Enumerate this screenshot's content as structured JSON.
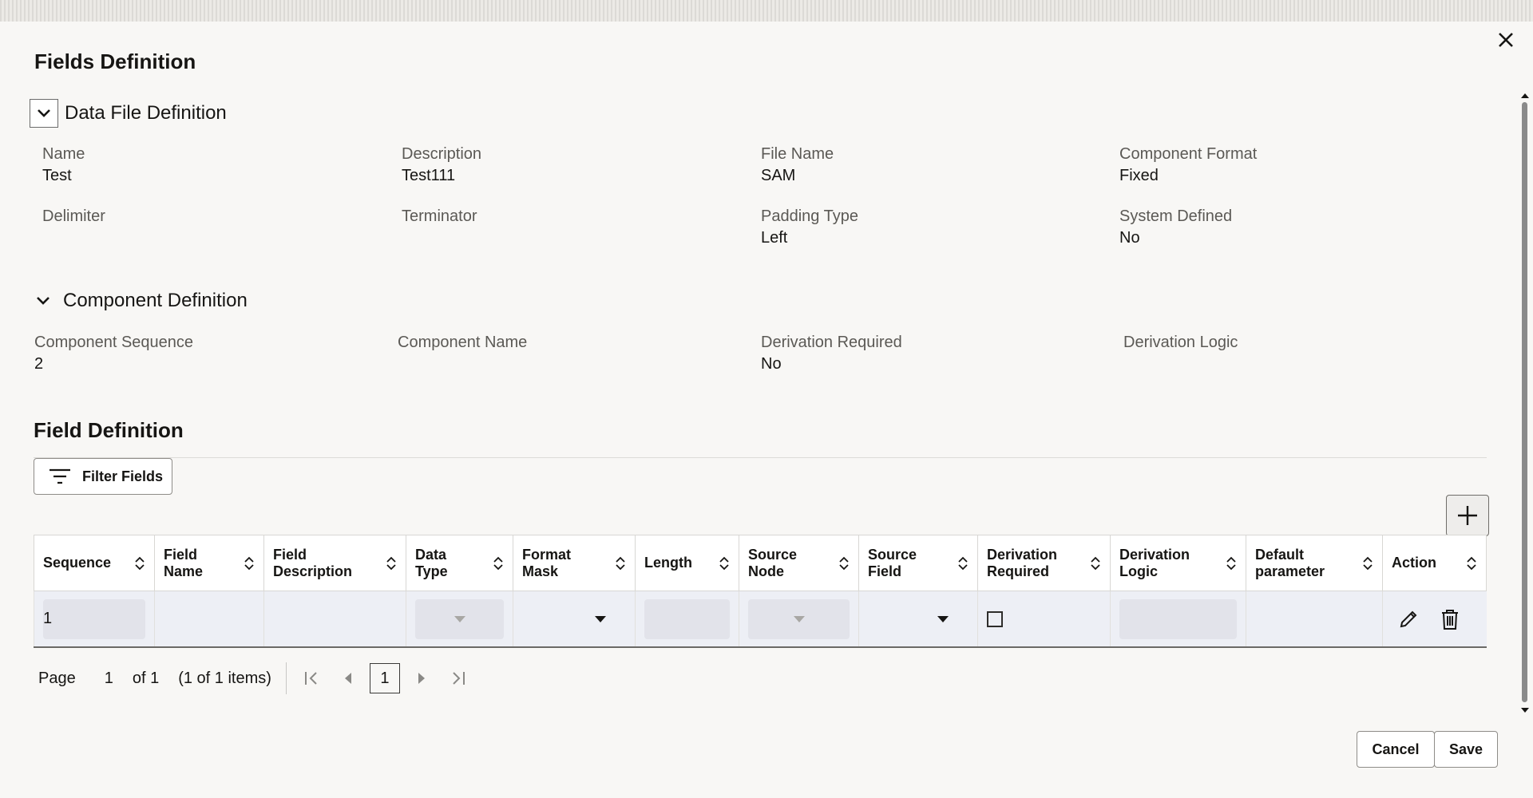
{
  "dialog": {
    "title": "Fields Definition",
    "close_icon": "close-icon"
  },
  "data_file_section": {
    "title": "Data File Definition",
    "fields": [
      {
        "label": "Name",
        "value": "Test"
      },
      {
        "label": "Description",
        "value": "Test111"
      },
      {
        "label": "File Name",
        "value": "SAM"
      },
      {
        "label": "Component Format",
        "value": "Fixed"
      },
      {
        "label": "Delimiter",
        "value": ""
      },
      {
        "label": "Terminator",
        "value": ""
      },
      {
        "label": "Padding Type",
        "value": "Left"
      },
      {
        "label": "System Defined",
        "value": "No"
      }
    ]
  },
  "component_section": {
    "title": "Component Definition",
    "fields": [
      {
        "label": "Component Sequence",
        "value": "2"
      },
      {
        "label": "Component Name",
        "value": ""
      },
      {
        "label": "Derivation Required",
        "value": "No"
      },
      {
        "label": "Derivation Logic",
        "value": ""
      }
    ]
  },
  "field_definition": {
    "title": "Field Definition",
    "filter_label": "Filter Fields",
    "columns": [
      {
        "line1": "Sequence",
        "line2": ""
      },
      {
        "line1": "Field",
        "line2": "Name"
      },
      {
        "line1": "Field",
        "line2": "Description"
      },
      {
        "line1": "Data",
        "line2": "Type"
      },
      {
        "line1": "Format",
        "line2": "Mask"
      },
      {
        "line1": "Length",
        "line2": ""
      },
      {
        "line1": "Source",
        "line2": "Node"
      },
      {
        "line1": "Source",
        "line2": "Field"
      },
      {
        "line1": "Derivation",
        "line2": "Required"
      },
      {
        "line1": "Derivation",
        "line2": "Logic"
      },
      {
        "line1": "Default",
        "line2": "parameter"
      },
      {
        "line1": "Action",
        "line2": ""
      }
    ],
    "row": {
      "sequence": "1",
      "derivation_required": false
    }
  },
  "pager": {
    "page_label": "Page",
    "page": "1",
    "of_label": "of 1",
    "items_label": "(1 of 1 items)",
    "current": "1"
  },
  "buttons": {
    "cancel": "Cancel",
    "save": "Save"
  }
}
